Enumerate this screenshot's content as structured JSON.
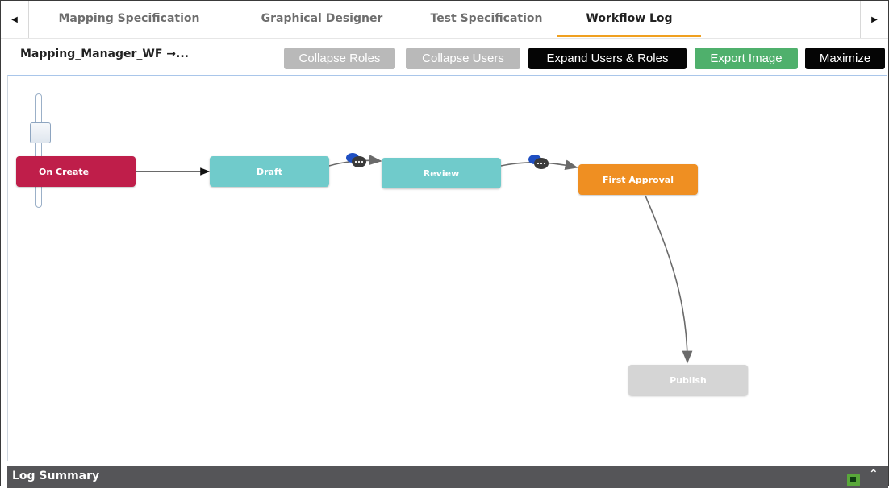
{
  "tabs": {
    "items": [
      {
        "label": "Mapping Specification"
      },
      {
        "label": "Graphical Designer"
      },
      {
        "label": "Test Specification"
      },
      {
        "label": "Workflow Log"
      }
    ],
    "active_tab": "Workflow Log",
    "left_arrow_icon": "caret-left-icon",
    "right_arrow_icon": "caret-right-icon"
  },
  "toolbar": {
    "workflow_title": "Mapping_Manager_WF →...",
    "collapse_roles": "Collapse Roles",
    "collapse_users": "Collapse Users",
    "expand_users_roles": "Expand Users & Roles",
    "export_image": "Export Image",
    "maximize": "Maximize"
  },
  "diagram": {
    "nodes": {
      "on_create": "On Create",
      "draft": "Draft",
      "review": "Review",
      "first_approval": "First Approval",
      "publish": "Publish"
    },
    "zoom_slider_icon": "zoom-slider",
    "comment_icon": "speech-bubbles-icon"
  },
  "log_summary": {
    "label": "Log Summary",
    "export_icon": "excel-export-icon",
    "collapse_icon": "chevron-up-icon"
  },
  "colors": {
    "active_tab_underline": "#f0a020",
    "on_create": "#bf1e4a",
    "draft_review": "#70cbcb",
    "first_approval": "#ef8f22",
    "publish": "#d5d5d5",
    "export_button": "#4fb06c",
    "log_bar": "#555558"
  }
}
